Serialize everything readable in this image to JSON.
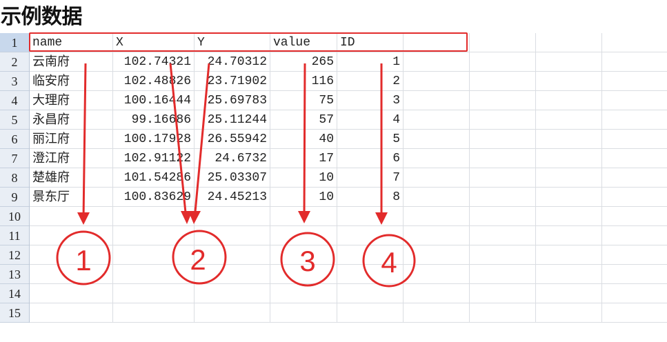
{
  "title": "示例数据",
  "columns": [
    "name",
    "X",
    "Y",
    "value",
    "ID"
  ],
  "row_numbers": [
    "1",
    "2",
    "3",
    "4",
    "5",
    "6",
    "7",
    "8",
    "9",
    "10",
    "11",
    "12",
    "13",
    "14",
    "15"
  ],
  "rows": [
    {
      "name": "云南府",
      "x": "102.74321",
      "y": "24.70312",
      "value": "265",
      "id": "1"
    },
    {
      "name": "临安府",
      "x": "102.48826",
      "y": "23.71902",
      "value": "116",
      "id": "2"
    },
    {
      "name": "大理府",
      "x": "100.16444",
      "y": "25.69783",
      "value": "75",
      "id": "3"
    },
    {
      "name": "永昌府",
      "x": "99.16686",
      "y": "25.11244",
      "value": "57",
      "id": "4"
    },
    {
      "name": "丽江府",
      "x": "100.17928",
      "y": "26.55942",
      "value": "40",
      "id": "5"
    },
    {
      "name": "澄江府",
      "x": "102.91122",
      "y": "24.6732",
      "value": "17",
      "id": "6"
    },
    {
      "name": "楚雄府",
      "x": "101.54286",
      "y": "25.03307",
      "value": "10",
      "id": "7"
    },
    {
      "name": "景东厅",
      "x": "100.83629",
      "y": "24.45213",
      "value": "10",
      "id": "8"
    }
  ],
  "markers": [
    "1",
    "2",
    "3",
    "4"
  ],
  "colors": {
    "annotation": "#e22b2b",
    "row_header_bg": "#e9eef5",
    "gridline": "#dadde2"
  }
}
